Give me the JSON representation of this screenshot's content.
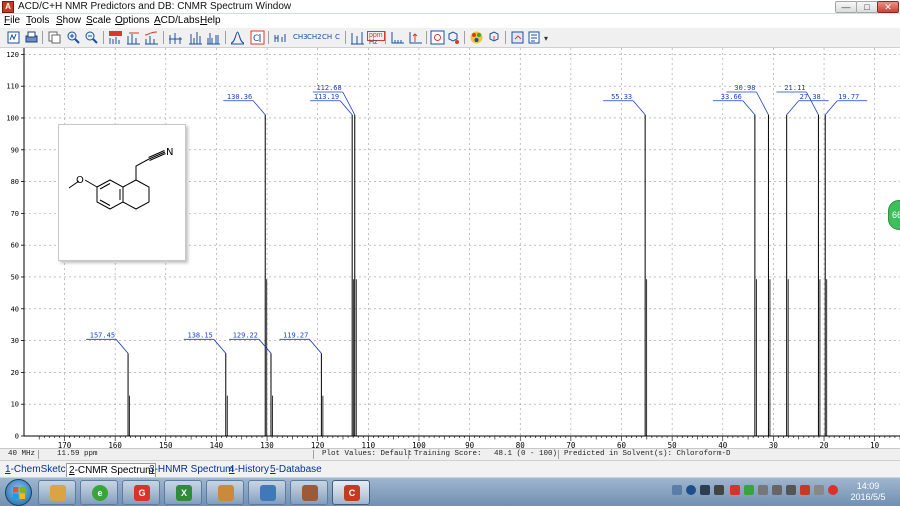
{
  "window": {
    "title": "ACD/C+H NMR Predictors and DB: CNMR Spectrum Window",
    "app_icon": "acd-app-icon",
    "controls": {
      "min": "—",
      "max": "□",
      "close": "✕"
    }
  },
  "menu": [
    "File",
    "Tools",
    "Show",
    "Scale",
    "Options",
    "ACD/Labs",
    "Help"
  ],
  "toolbar": {
    "unit_ppm": "ppm",
    "unit_hz": "Hz",
    "ch_labels": [
      "CH3",
      "CH2",
      "CH",
      "C"
    ],
    "overflow": "▾"
  },
  "spectrum": {
    "y_ticks": [
      0,
      10,
      20,
      30,
      40,
      50,
      60,
      70,
      80,
      90,
      100,
      110,
      120
    ],
    "x_ticks": [
      170,
      160,
      150,
      140,
      130,
      120,
      110,
      100,
      90,
      80,
      70,
      60,
      50,
      40,
      30,
      20,
      10
    ],
    "x_range": [
      178,
      5
    ],
    "y_range": [
      0,
      122
    ],
    "grid": true,
    "peaks": [
      {
        "ppm": 157.45,
        "label": "157.45",
        "height": 26
      },
      {
        "ppm": 138.15,
        "label": "138.15",
        "height": 26
      },
      {
        "ppm": 130.36,
        "label": "130.36",
        "height": 101
      },
      {
        "ppm": 129.22,
        "label": "129.22",
        "height": 26
      },
      {
        "ppm": 119.27,
        "label": "119.27",
        "height": 26
      },
      {
        "ppm": 113.19,
        "label": "113.19",
        "height": 101
      },
      {
        "ppm": 112.68,
        "label": "112.68",
        "height": 101
      },
      {
        "ppm": 55.33,
        "label": "55.33",
        "height": 101
      },
      {
        "ppm": 33.66,
        "label": "33.66",
        "height": 101
      },
      {
        "ppm": 30.98,
        "label": "30.98",
        "height": 101
      },
      {
        "ppm": 27.38,
        "label": "27.38",
        "height": 101
      },
      {
        "ppm": 21.11,
        "label": "21.11",
        "height": 101
      },
      {
        "ppm": 19.77,
        "label": "19.77",
        "height": 101
      }
    ],
    "structure": {
      "atom_labels": [
        "O",
        "N"
      ]
    }
  },
  "badge": {
    "text": "66",
    "color": "#3fbf5c"
  },
  "status": {
    "frequency": "40 MHz",
    "cursor": "11.59 ppm",
    "plot_values": "Plot Values: Default",
    "training_score_label": "Training Score:",
    "training_score_value": "48.1 (0 - 100)",
    "solvent": "Predicted in Solvent(s): Chloroform-D"
  },
  "tabs": [
    {
      "num": "1",
      "label": "-ChemSketch"
    },
    {
      "num": "2",
      "label": "-CNMR Spectrum",
      "active": true
    },
    {
      "num": "3",
      "label": "-HNMR Spectrum"
    },
    {
      "num": "4",
      "label": "-History"
    },
    {
      "num": "5",
      "label": "-Database"
    }
  ],
  "taskbar": {
    "apps": [
      {
        "name": "explorer-folder-icon",
        "color": "#d9a441"
      },
      {
        "name": "ie-icon",
        "color": "#3aa43a"
      },
      {
        "name": "g-app-icon",
        "color": "#d8322a",
        "glyph": "G"
      },
      {
        "name": "excel-icon",
        "color": "#2f8a3b",
        "glyph": "X"
      },
      {
        "name": "paint-icon",
        "color": "#c98b3a"
      },
      {
        "name": "image-viewer-icon",
        "color": "#3f79b8"
      },
      {
        "name": "photo-app-icon",
        "color": "#9b5a3a"
      },
      {
        "name": "acd-chem-icon",
        "color": "#c23b22",
        "glyph": "C",
        "active": true
      }
    ],
    "clock": {
      "time": "14:09",
      "date": "2016/5/5"
    }
  }
}
